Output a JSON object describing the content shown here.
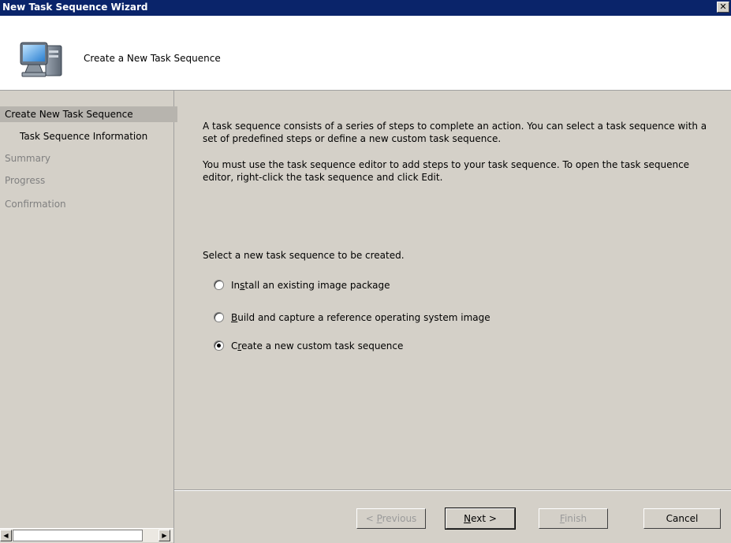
{
  "window": {
    "title": "New Task Sequence Wizard",
    "close_glyph": "✕",
    "icon": "computer-wizard-icon"
  },
  "header": {
    "page_title": "Create a New Task Sequence"
  },
  "sidebar": {
    "items": [
      {
        "label": "Create New Task Sequence",
        "state": "active"
      },
      {
        "label": "Task Sequence Information",
        "state": "normal"
      },
      {
        "label": "Summary",
        "state": "disabled"
      },
      {
        "label": "Progress",
        "state": "disabled"
      },
      {
        "label": "Confirmation",
        "state": "disabled"
      }
    ],
    "scroll_left_glyph": "◀",
    "scroll_right_glyph": "▶"
  },
  "content": {
    "para1": "A task sequence consists of a series of steps to complete an action. You can select a task sequence with a set of predefined steps or define a new custom task sequence.",
    "para2": "You must use the task sequence editor to add steps to your task sequence. To open the task sequence editor, right-click the task sequence and click Edit.",
    "prompt": "Select a new task sequence to be created.",
    "options": [
      {
        "pre": "In",
        "ul": "s",
        "post": "tall an existing image package",
        "checked": false
      },
      {
        "pre": "",
        "ul": "B",
        "post": "uild and capture a reference operating system image",
        "checked": false
      },
      {
        "pre": "C",
        "ul": "r",
        "post": "eate a new custom task sequence",
        "checked": true
      }
    ]
  },
  "buttons": {
    "previous": {
      "pre": "< ",
      "ul": "P",
      "post": "revious",
      "enabled": false
    },
    "next": {
      "pre": "",
      "ul": "N",
      "post": "ext >",
      "enabled": true
    },
    "finish": {
      "pre": "",
      "ul": "F",
      "post": "inish",
      "enabled": false
    },
    "cancel": {
      "label": "Cancel",
      "enabled": true
    }
  },
  "colors": {
    "titlebar": "#0a246a",
    "face": "#d4d0c8",
    "active_nav": "#b7b4ae"
  }
}
